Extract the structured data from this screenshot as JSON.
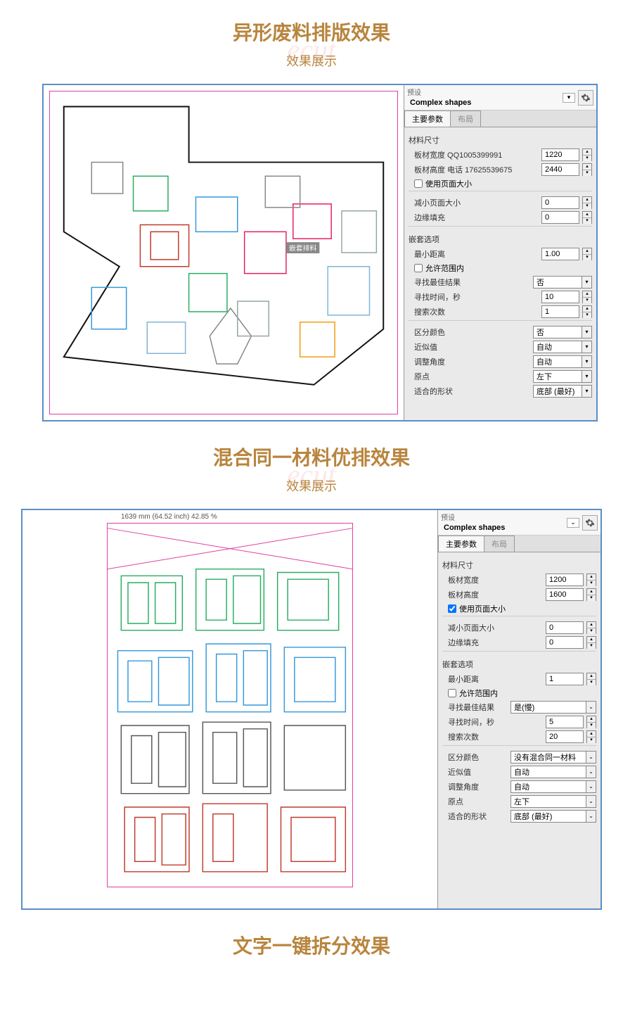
{
  "section1": {
    "title": "异形废料排版效果",
    "subtitle": "效果展示",
    "watermark": "ecut"
  },
  "section2": {
    "title": "混合同一材料优排效果",
    "subtitle": "效果展示",
    "watermark": "ecut"
  },
  "section3": {
    "title": "文字一键拆分效果"
  },
  "app1": {
    "status_bar": "",
    "preset_label": "预设",
    "preset_value": "Complex shapes",
    "tabs": {
      "main": "主要参数",
      "layout": "布局"
    },
    "groups": {
      "material_size": "材料尺寸",
      "nesting_options": "嵌套选项"
    },
    "fields": {
      "width_label": "板材宽度 QQ1005399991",
      "width_value": "1220",
      "height_label": "板材高度 电话 17625539675",
      "height_value": "2440",
      "use_page_size": "使用页面大小",
      "reduce_page_label": "减小页面大小",
      "reduce_page_value": "0",
      "margin_label": "边缘填充",
      "margin_value": "0",
      "min_dist_label": "最小距离",
      "min_dist_value": "1.00",
      "allow_inside": "允许范围内",
      "best_result_label": "寻找最佳结果",
      "best_result_value": "否",
      "search_time_label": "寻找时间，秒",
      "search_time_value": "10",
      "search_count_label": "搜索次数",
      "search_count_value": "1",
      "color_sep_label": "区分颜色",
      "color_sep_value": "否",
      "approx_label": "近似值",
      "approx_value": "自动",
      "angle_label": "调整角度",
      "angle_value": "自动",
      "origin_label": "原点",
      "origin_value": "左下",
      "fit_shape_label": "适合的形状",
      "fit_shape_value": "底部 (最好)"
    },
    "tooltip": "嵌套排料"
  },
  "app2": {
    "ruler": "1639 mm (64.52 inch)  42.85 %",
    "preset_label": "预设",
    "preset_value": "Complex shapes",
    "tabs": {
      "main": "主要参数",
      "layout": "布局"
    },
    "groups": {
      "material_size": "材料尺寸",
      "nesting_options": "嵌套选项"
    },
    "fields": {
      "width_label": "板材宽度",
      "width_value": "1200",
      "height_label": "板材高度",
      "height_value": "1600",
      "use_page_size": "使用页面大小",
      "reduce_page_label": "减小页面大小",
      "reduce_page_value": "0",
      "margin_label": "边缘填充",
      "margin_value": "0",
      "min_dist_label": "最小距离",
      "min_dist_value": "1",
      "allow_inside": "允许范围内",
      "best_result_label": "寻找最佳结果",
      "best_result_value": "是(慢)",
      "search_time_label": "寻找时间，秒",
      "search_time_value": "5",
      "search_count_label": "搜索次数",
      "search_count_value": "20",
      "color_sep_label": "区分颜色",
      "color_sep_value": "没有混合同一材料",
      "approx_label": "近似值",
      "approx_value": "自动",
      "angle_label": "调整角度",
      "angle_value": "自动",
      "origin_label": "原点",
      "origin_value": "左下",
      "fit_shape_label": "适合的形状",
      "fit_shape_value": "底部 (最好)"
    }
  }
}
